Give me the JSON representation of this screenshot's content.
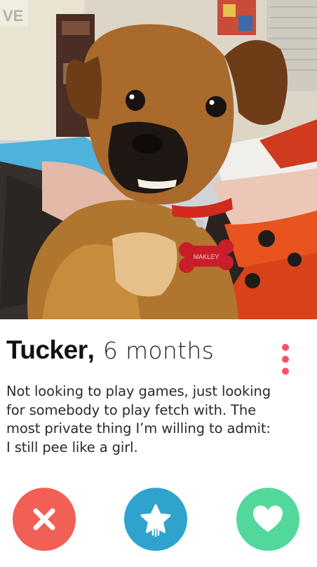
{
  "profile": {
    "name": "Tucker",
    "name_separator": ",",
    "age": "6 months",
    "bio_lines": [
      "Not looking to play games, just looking",
      "for somebody to play fetch with. The",
      "most private thing I’m willing to admit:",
      "I still pee like a girl."
    ]
  },
  "photo": {
    "subject": "dog-photo",
    "tag_text": "MAKLEY"
  },
  "actions": {
    "nope_icon": "close-icon",
    "superlike_icon": "star-icon",
    "like_icon": "heart-icon"
  },
  "colors": {
    "accent_dots": "#fd5068",
    "nope": "#f25f55",
    "superlike": "#2fa3ce",
    "like": "#52d89b"
  }
}
